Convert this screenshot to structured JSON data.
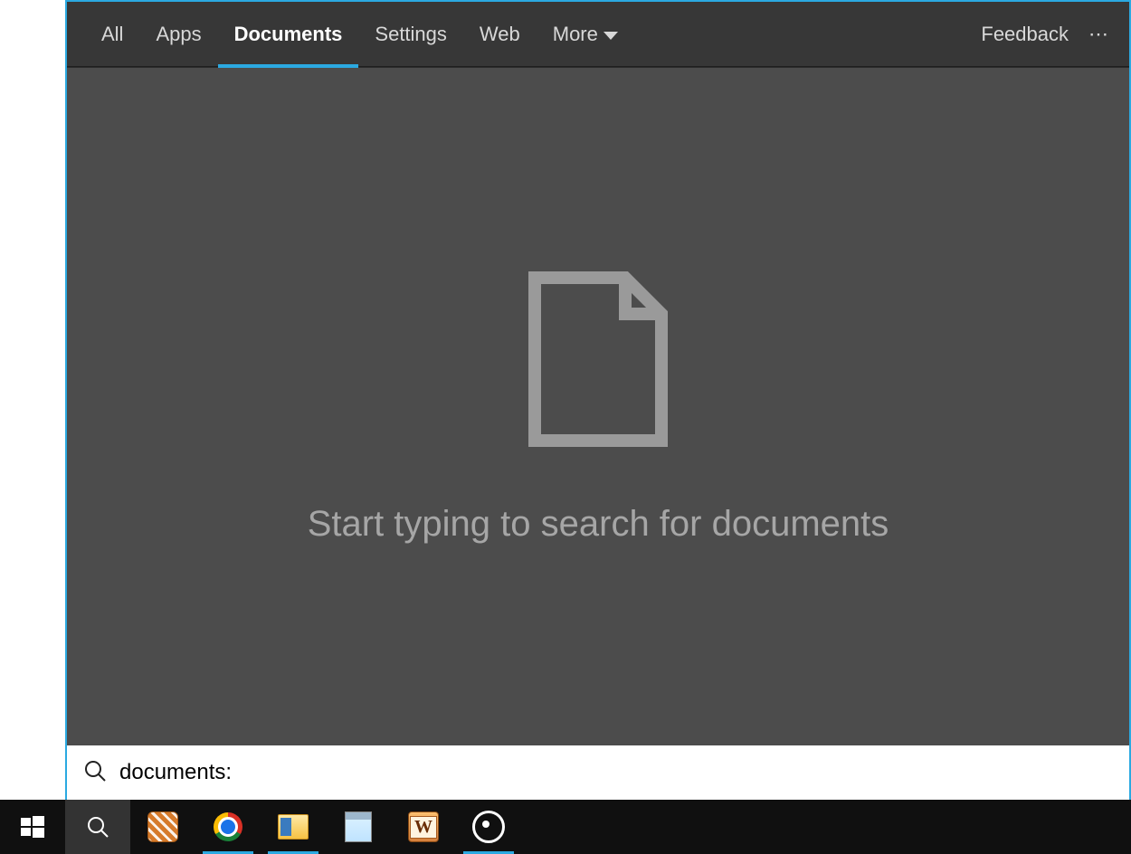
{
  "tabs": {
    "all": "All",
    "apps": "Apps",
    "documents": "Documents",
    "settings": "Settings",
    "web": "Web",
    "more": "More",
    "active": "documents"
  },
  "header": {
    "feedback": "Feedback",
    "more_options": "⋯"
  },
  "body": {
    "hint": "Start typing to search for documents"
  },
  "search": {
    "value": "documents: "
  },
  "taskbar": {
    "start": "start-button",
    "search": "search-button",
    "apps": [
      {
        "name": "hatch-app",
        "running": false
      },
      {
        "name": "chrome",
        "running": true
      },
      {
        "name": "file-explorer",
        "running": true
      },
      {
        "name": "notepad",
        "running": false
      },
      {
        "name": "word-processor",
        "running": false
      },
      {
        "name": "groove-music",
        "running": true
      }
    ]
  },
  "word_tile_letter": "W",
  "colors": {
    "accent": "#2BA9E1",
    "panel_bg": "#4c4c4c",
    "header_bg": "#373737",
    "taskbar_bg": "#101010"
  }
}
